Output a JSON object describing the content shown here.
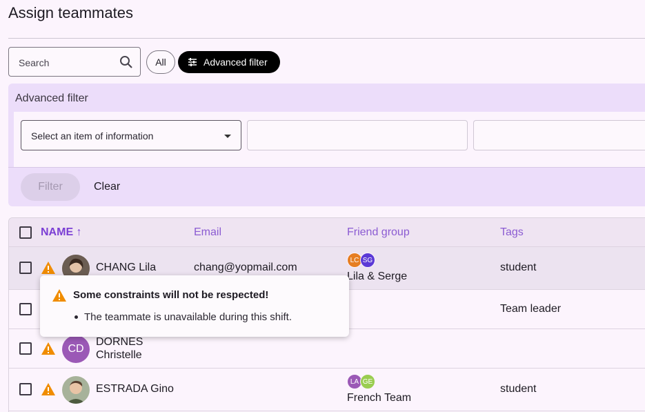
{
  "page": {
    "title": "Assign teammates"
  },
  "search": {
    "placeholder": "Search"
  },
  "chips": {
    "all": "All",
    "advanced": "Advanced filter"
  },
  "advanced_filter": {
    "title": "Advanced filter",
    "select_placeholder": "Select an item of information",
    "filter_label": "Filter",
    "clear_label": "Clear"
  },
  "table": {
    "columns": {
      "name": "NAME ↑",
      "email": "Email",
      "friend_group": "Friend group",
      "tags": "Tags"
    },
    "rows": [
      {
        "name": "CHANG Lila",
        "email": "chang@yopmail.com",
        "group_badges": [
          "LC",
          "SG"
        ],
        "group": "Lila & Serge",
        "tag": "student",
        "warning": true
      },
      {
        "name": "",
        "email": "",
        "group_badges": [],
        "group": "",
        "tag": "Team leader",
        "warning": true
      },
      {
        "name_line1": "DORNES",
        "name_line2": "Christelle",
        "initials": "CD",
        "email": "",
        "group": "",
        "tag": "",
        "warning": true
      },
      {
        "name": "ESTRADA Gino",
        "email": "",
        "group_badges": [
          "LA",
          "GE"
        ],
        "group": "French Team",
        "tag": "student",
        "warning": true
      }
    ]
  },
  "tooltip": {
    "title": "Some constraints will not be respected!",
    "items": [
      "The teammate is unavailable during this shift."
    ]
  },
  "colors": {
    "accent": "#7b3fd4",
    "panel": "#ecddfa",
    "warning": "#f08c00"
  }
}
